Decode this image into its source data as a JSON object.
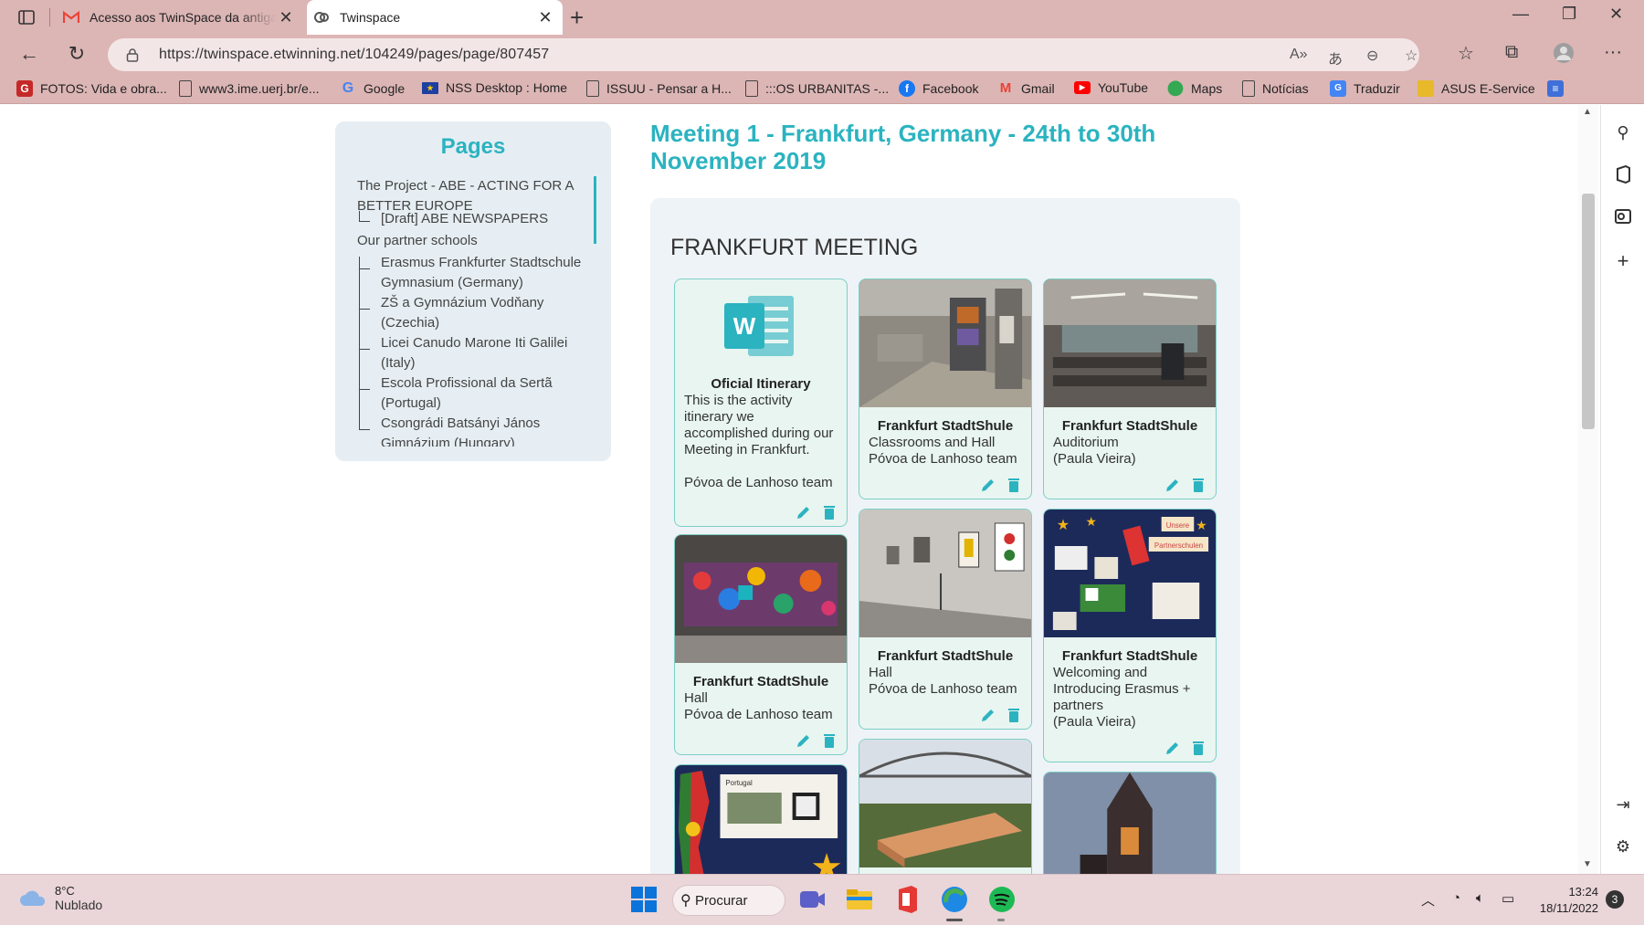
{
  "browser": {
    "tabs": [
      {
        "title": "Acesso aos TwinSpace da antiga",
        "icon": "gmail-icon"
      },
      {
        "title": "Twinspace",
        "icon": "twinspace-icon"
      }
    ],
    "url": "https://twinspace.etwinning.net/104249/pages/page/807457"
  },
  "bookmarks": [
    {
      "label": "FOTOS: Vida e obra...",
      "icon": "gallery-icon",
      "color": "#c62828"
    },
    {
      "label": "www3.ime.uerj.br/e...",
      "icon": "page-icon"
    },
    {
      "label": "Google",
      "icon": "google-icon",
      "color": "#4285f4"
    },
    {
      "label": "NSS Desktop : Home",
      "icon": "eu-flag-icon",
      "color": "#1e3fa0"
    },
    {
      "label": "ISSUU - Pensar a H...",
      "icon": "page-icon"
    },
    {
      "label": ":::OS URBANITAS -...",
      "icon": "page-icon"
    },
    {
      "label": "Facebook",
      "icon": "facebook-icon",
      "color": "#1877f2"
    },
    {
      "label": "Gmail",
      "icon": "gmail-icon",
      "color": "#ea4335"
    },
    {
      "label": "YouTube",
      "icon": "youtube-icon",
      "color": "#ff0000"
    },
    {
      "label": "Maps",
      "icon": "maps-icon",
      "color": "#34a853"
    },
    {
      "label": "Notícias",
      "icon": "page-icon"
    },
    {
      "label": "Traduzir",
      "icon": "translate-icon",
      "color": "#4285f4"
    },
    {
      "label": "ASUS E-Service",
      "icon": "folder-icon",
      "color": "#e8b92a"
    }
  ],
  "sidebar": {
    "heading": "Pages",
    "items": [
      "The Project - ABE - ACTING FOR A BETTER EUROPE",
      "[Draft] ABE NEWSPAPERS",
      "Our partner schools",
      "Erasmus Frankfurter Stadtschule Gymnasium (Germany)",
      "ZŠ a Gymnázium Vodňany (Czechia)",
      "Licei Canudo Marone Iti Galilei (Italy)",
      "Escola Profissional da Sertã (Portugal)",
      "Csongrádi Batsányi János",
      "Gimnázium (Hungary)"
    ]
  },
  "page": {
    "title": "Meeting 1 - Frankfurt, Germany - 24th to 30th November 2019",
    "section": "FRANKFURT MEETING"
  },
  "cards": [
    {
      "title": "Oficial Itinerary",
      "lines": [
        "This is the activity itinerary we accomplished during our Meeting in Frankfurt.",
        "Póvoa de Lanhoso team"
      ]
    },
    {
      "title": "Frankfurt StadtShule",
      "lines": [
        "Classrooms and Hall",
        "Póvoa de Lanhoso team"
      ]
    },
    {
      "title": "Frankfurt StadtShule",
      "lines": [
        "Auditorium",
        "(Paula Vieira)"
      ]
    },
    {
      "title": "Frankfurt StadtShule",
      "lines": [
        "Hall",
        "Póvoa de Lanhoso team"
      ]
    },
    {
      "title": "Frankfurt StadtShule",
      "lines": [
        "Hall",
        "Póvoa de Lanhoso team"
      ]
    },
    {
      "title": "Frankfurt StadtShule",
      "lines": [
        "Welcoming and Introducing Erasmus + partners",
        "(Paula Vieira)"
      ]
    }
  ],
  "card_image_labels": {
    "unsere": "Unsere",
    "partnerschulen": "Partnerschulen",
    "poster": "Portugal"
  },
  "taskbar": {
    "weather_temp": "8°C",
    "weather_desc": "Nublado",
    "search": "Procurar",
    "time": "13:24",
    "date": "18/11/2022",
    "notifications": "3"
  },
  "colors": {
    "accent": "#2bb3c0",
    "chrome": "#dcb5b5",
    "card_border": "#7cd0c6"
  }
}
